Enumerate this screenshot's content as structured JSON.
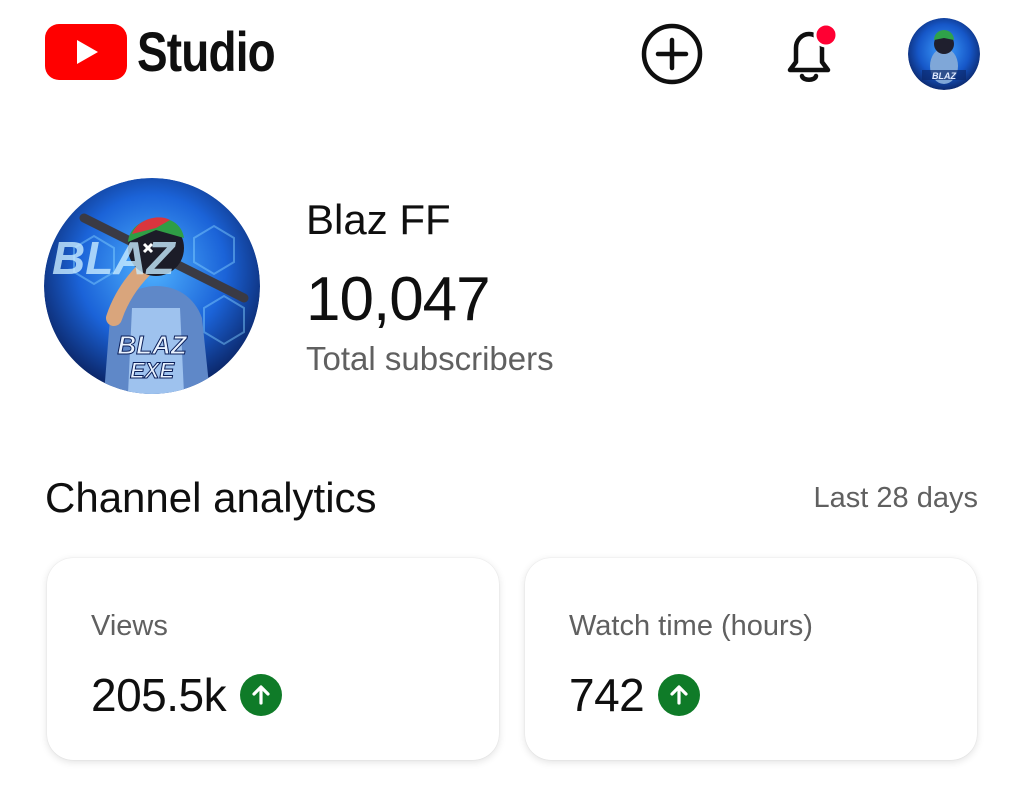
{
  "header": {
    "logo_text": "Studio",
    "brand_color": "#ff0000",
    "create_icon": "add-circle-icon",
    "notifications_icon": "bell-icon",
    "notification_dot_color": "#ff0033"
  },
  "channel": {
    "name": "Blaz FF",
    "subscriber_count": "10,047",
    "subscriber_label": "Total subscribers",
    "avatar_text_top": "BLAZ",
    "avatar_text_bottom": "EXE"
  },
  "analytics": {
    "title": "Channel analytics",
    "range": "Last 28 days",
    "cards": [
      {
        "label": "Views",
        "value": "205.5k",
        "trend": "up",
        "trend_color": "#0f7b28"
      },
      {
        "label": "Watch time (hours)",
        "value": "742",
        "trend": "up",
        "trend_color": "#0f7b28"
      }
    ]
  }
}
